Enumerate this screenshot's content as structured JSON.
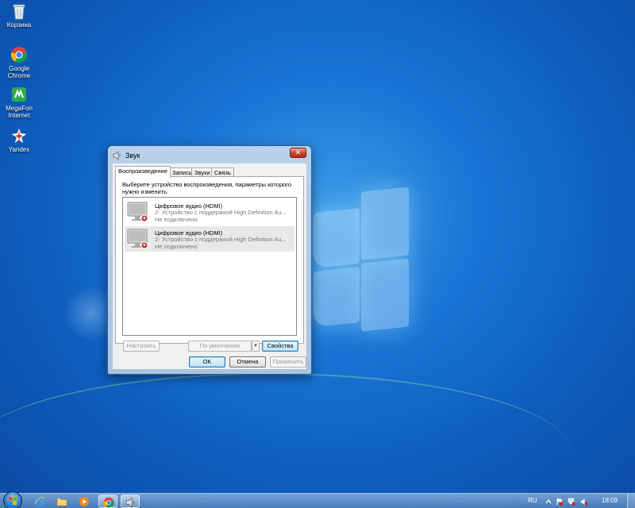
{
  "desktop": {
    "icons": [
      {
        "label": "Корзина"
      },
      {
        "label": "Google Chrome"
      },
      {
        "label": "MegaFon Internet"
      },
      {
        "label": "Yandex"
      }
    ]
  },
  "dialog": {
    "title": "Звук",
    "close_glyph": "✕",
    "tabs": [
      {
        "label": "Воспроизведение",
        "active": true
      },
      {
        "label": "Запись"
      },
      {
        "label": "Звуки"
      },
      {
        "label": "Связь"
      }
    ],
    "instruction": "Выберите устройство воспроизведения, параметры которого нужно изменить:",
    "devices": [
      {
        "name": "Цифровое аудио (HDMI)",
        "description": "2- Устройство с поддержкой High Definition Au...",
        "status": "Не подключено"
      },
      {
        "name": "Цифровое аудио (HDMI)",
        "description": "2- Устройство с поддержкой High Definition Au...",
        "status": "Не подключено",
        "selected": true
      }
    ],
    "configure_label": "Настроить",
    "default_label": "По умолчанию",
    "default_arrow": "▼",
    "properties_label": "Свойства",
    "ok_label": "OK",
    "cancel_label": "Отмена",
    "apply_label": "Применить"
  },
  "taskbar": {
    "language": "RU",
    "clock": "18:09",
    "pinned": [
      "internet-explorer-icon",
      "explorer-folder-icon",
      "media-player-icon",
      "chrome-icon",
      "sound-icon"
    ]
  },
  "colors": {
    "desktop_blue": "#1a78d6",
    "dialog_frame": "#b9d1ea",
    "close_red": "#c8412b",
    "status_gray": "#7a7a7a"
  }
}
